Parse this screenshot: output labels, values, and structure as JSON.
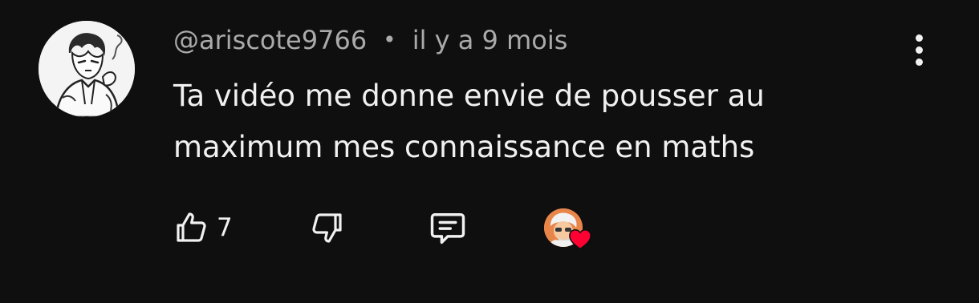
{
  "comment": {
    "author": "@ariscote9766",
    "separator": "•",
    "timestamp": "il y a 9 mois",
    "text_lines": [
      "Ta vidéo me donne envie de pousser au",
      "maximum mes connaissance en maths"
    ],
    "like_count": "7"
  },
  "colors": {
    "background": "#0f0f0f",
    "text_primary": "#f1f1f1",
    "text_secondary": "#aaaaaa",
    "heart": "#ff0033"
  },
  "icons": {
    "like": "thumbs-up-icon",
    "dislike": "thumbs-down-icon",
    "reply": "chat-bubble-icon",
    "more": "vertical-dots-icon",
    "creator_heart": "heart-icon"
  }
}
